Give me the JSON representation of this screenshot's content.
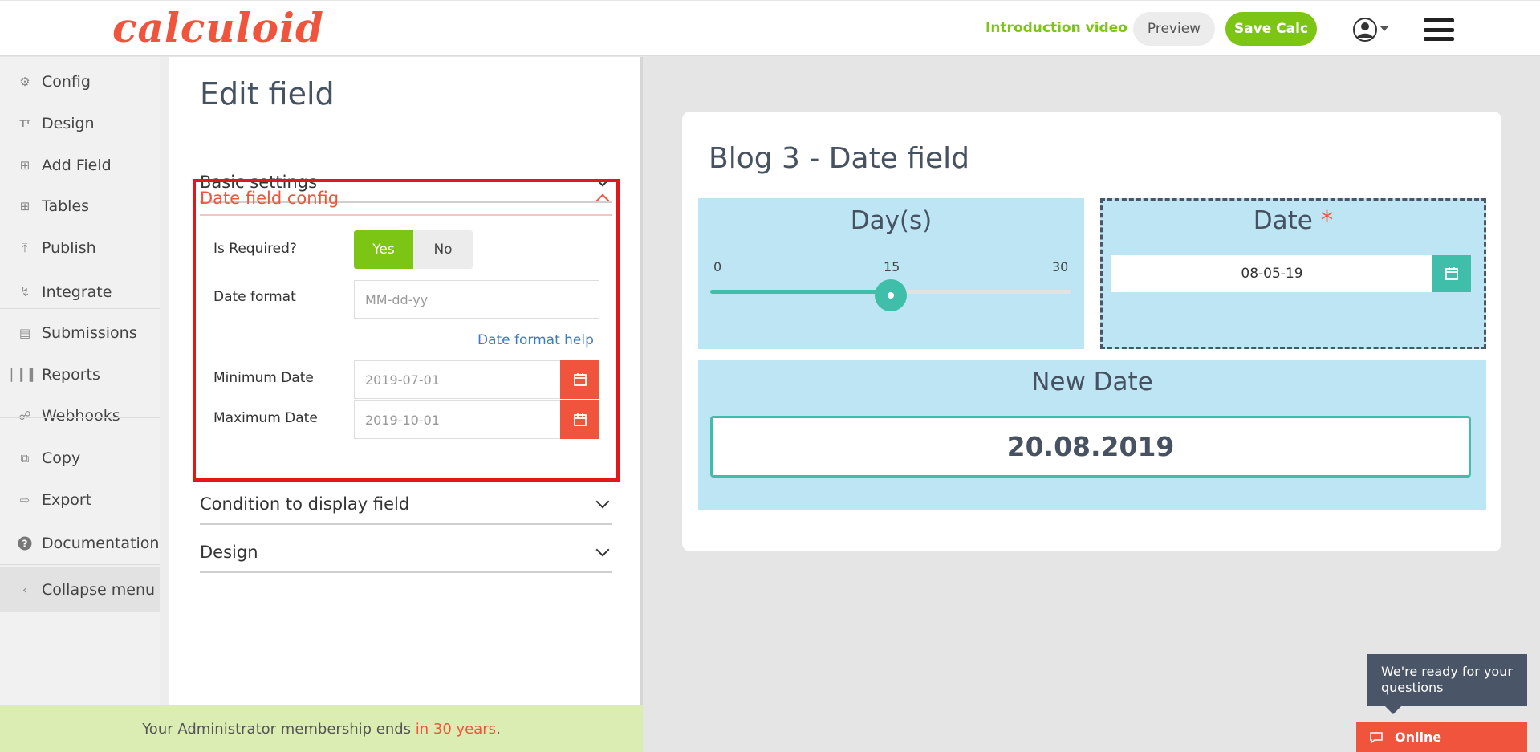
{
  "header": {
    "logo": "calculoid",
    "intro_link": "Introduction video",
    "preview_label": "Preview",
    "save_label": "Save Calc"
  },
  "sidebar": {
    "items": [
      {
        "label": "Config",
        "icon": "gear-icon"
      },
      {
        "label": "Design",
        "icon": "text-size-icon"
      },
      {
        "label": "Add Field",
        "icon": "plus-square-icon"
      },
      {
        "label": "Tables",
        "icon": "table-icon"
      },
      {
        "label": "Publish",
        "icon": "upload-icon"
      },
      {
        "label": "Integrate",
        "icon": "flow-icon"
      },
      {
        "label": "Submissions",
        "icon": "inbox-icon"
      },
      {
        "label": "Reports",
        "icon": "bar-chart-icon"
      },
      {
        "label": "Webhooks",
        "icon": "webhook-icon"
      },
      {
        "label": "Copy",
        "icon": "copy-icon"
      },
      {
        "label": "Export",
        "icon": "export-icon"
      },
      {
        "label": "Documentation",
        "icon": "question-circle-icon"
      },
      {
        "label": "Collapse menu",
        "icon": "chevron-left-icon"
      }
    ]
  },
  "edit_panel": {
    "title": "Edit field",
    "sections": {
      "basic": "Basic settings",
      "date_config": "Date field config",
      "condition": "Condition to display field",
      "design": "Design"
    },
    "date_config": {
      "is_required_label": "Is Required?",
      "yes": "Yes",
      "no": "No",
      "format_label": "Date format",
      "format_placeholder": "MM-dd-yy",
      "format_help": "Date format help",
      "min_label": "Minimum Date",
      "min_value": "2019-07-01",
      "max_label": "Maximum Date",
      "max_value": "2019-10-01"
    }
  },
  "preview": {
    "calc_title": "Blog 3 - Date field",
    "days_block": {
      "title": "Day(s)",
      "min": "0",
      "mid": "15",
      "max": "30",
      "value_fraction": 0.5
    },
    "date_block": {
      "title": "Date",
      "required_mark": "*",
      "value": "08-05-19"
    },
    "new_date_block": {
      "title": "New Date",
      "value": "20.08.2019"
    }
  },
  "footer": {
    "membership_text": "Your Administrator membership ends ",
    "membership_highlight": "in 30 years",
    "membership_end": "."
  },
  "chat": {
    "tooltip": "We're ready for your questions",
    "status": "Online"
  },
  "colors": {
    "brand": "#f0543c",
    "accent_green": "#7cc514",
    "teal": "#3fbfaa",
    "block_bg": "#bde5f3"
  }
}
